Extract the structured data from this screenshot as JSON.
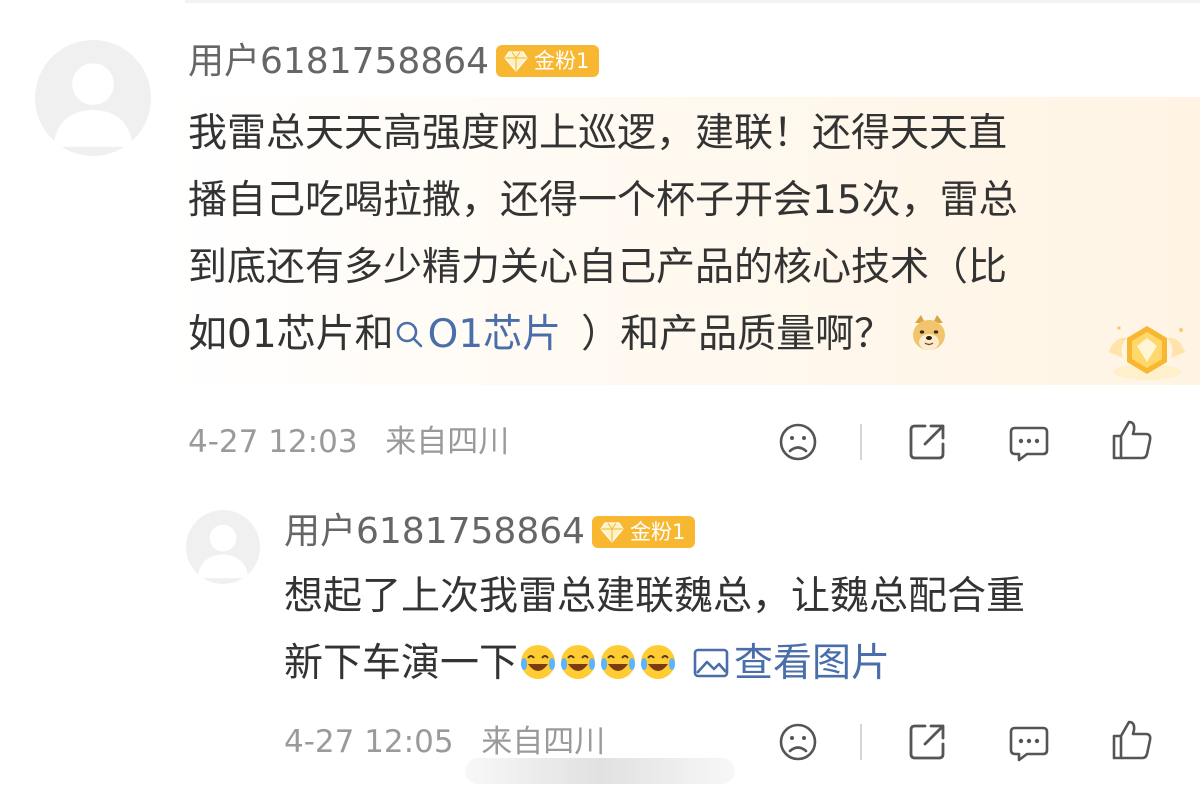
{
  "comment": {
    "username": "用户6181758864",
    "badge": "金粉1",
    "lines": [
      "我雷总天天高强度网上巡逻，建联！还得天天直",
      "播自己吃喝拉撒，还得一个杯子开会15次，雷总",
      "到底还有多少精力关心自己产品的核心技术（比"
    ],
    "line4_prefix": "如01芯片和",
    "line4_link": "O1芯片",
    "line4_suffix": "）和产品质量啊？",
    "emoji": "doge-emoji",
    "time": "4-27 12:03",
    "location": "来自四川"
  },
  "reply": {
    "username": "用户6181758864",
    "badge": "金粉1",
    "line1": "想起了上次我雷总建联魏总，让魏总配合重",
    "line2_prefix": "新下车演一下",
    "emojis": [
      "laugh-cry-emoji",
      "laugh-cry-emoji",
      "laugh-cry-emoji",
      "laugh-cry-emoji"
    ],
    "view_image": "查看图片",
    "time": "4-27 12:05",
    "location": "来自四川"
  },
  "icons": [
    "avatar-placeholder",
    "gem-icon",
    "search-icon",
    "sad-face-icon",
    "share-icon",
    "comment-icon",
    "like-icon",
    "image-icon",
    "medal-icon"
  ],
  "colors": {
    "badge": "#f7b731",
    "link": "#4a6ea9",
    "text": "#333333",
    "meta": "#9a9a9a",
    "username": "#666666"
  }
}
